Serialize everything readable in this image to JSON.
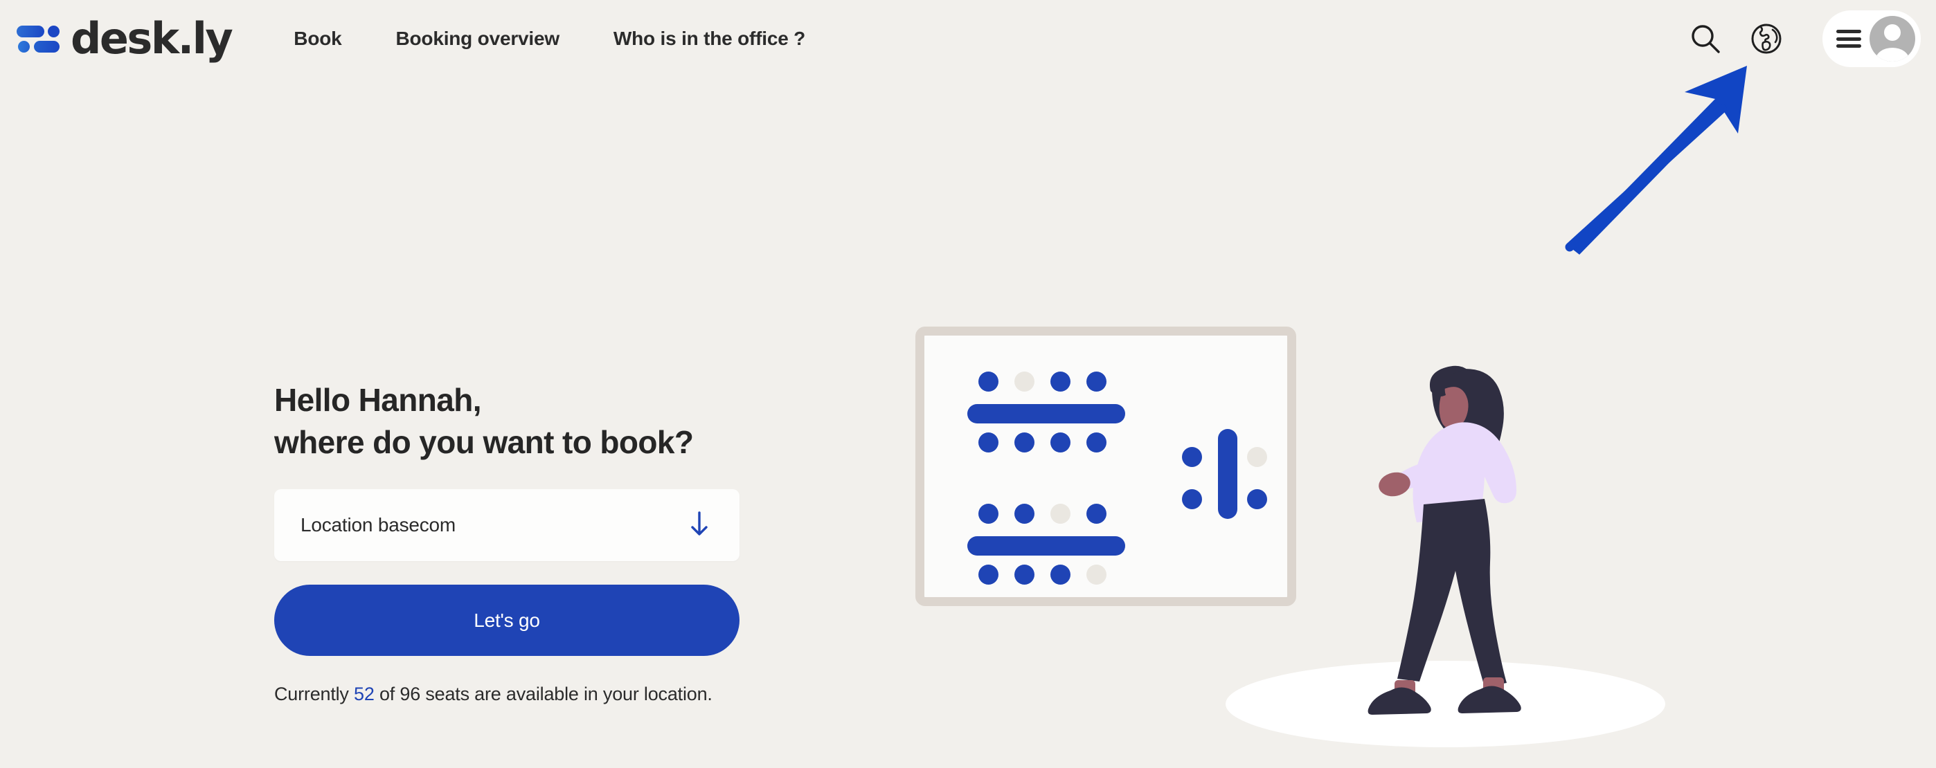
{
  "app": {
    "brand_name": "desk.ly",
    "background_color": "#F2F0EC",
    "accent_color": "#1F44B5",
    "logo_icon": "deskly-people-logo-icon"
  },
  "header": {
    "nav_items": [
      {
        "label": "Book",
        "name": "nav-book"
      },
      {
        "label": "Booking overview",
        "name": "nav-booking-overview"
      },
      {
        "label": "Who is in the office ?",
        "name": "nav-who-is-in-the-office"
      }
    ],
    "actions": [
      {
        "icon": "search-icon",
        "label": "Search"
      },
      {
        "icon": "globe-icon",
        "label": "Language"
      }
    ],
    "user_menu": {
      "menu_icon": "hamburger-menu-icon",
      "avatar_icon": "user-avatar-icon"
    }
  },
  "annotation": {
    "type": "arrow",
    "color": "#1145C4",
    "points_to": "globe-icon",
    "direction": "up-right"
  },
  "hero": {
    "greeting_line1": "Hello Hannah,",
    "greeting_line2": "where do you want to book?",
    "greeting_full": "Hello Hannah,\nwhere do you want to book?",
    "location_select": {
      "value": "Location basecom",
      "placeholder": "Location",
      "chevron_icon": "arrow-down-icon",
      "chevron_color": "#1F44B5"
    },
    "cta_label": "Let's go",
    "availability": {
      "prefix": "Currently ",
      "available_count": "52",
      "middle": " of ",
      "total_count": "96",
      "suffix": " seats are available in your location.",
      "full_text": "Currently 52 of 96 seats are available in your location."
    }
  },
  "illustration": {
    "room_card": {
      "border_color": "#DCD5CE",
      "fill_color": "#FBFBFA",
      "seat_color": "#1F44B5",
      "free_seat_color": "#EAE7E1",
      "desks": [
        {
          "name": "desk-top-horizontal",
          "orientation": "horizontal",
          "seats_above": [
            "booked",
            "free",
            "booked",
            "booked"
          ],
          "seats_below": [
            "booked",
            "booked",
            "booked",
            "booked"
          ]
        },
        {
          "name": "desk-bottom-horizontal",
          "orientation": "horizontal",
          "seats_above": [
            "booked",
            "booked",
            "free",
            "booked"
          ],
          "seats_below": [
            "booked",
            "booked",
            "booked",
            "free"
          ]
        },
        {
          "name": "desk-right-vertical",
          "orientation": "vertical",
          "seats_left": [
            "booked",
            "booked"
          ],
          "seats_right": [
            "free",
            "booked"
          ]
        }
      ]
    },
    "person": {
      "name": "walking-person-illustration",
      "hair_color": "#2F2E41",
      "skin_color": "#9F616A",
      "top_color": "#E9DAFB",
      "trousers_color": "#2F2E41",
      "shoe_color": "#2F2E41",
      "floor_color": "#FFFFFF"
    }
  }
}
